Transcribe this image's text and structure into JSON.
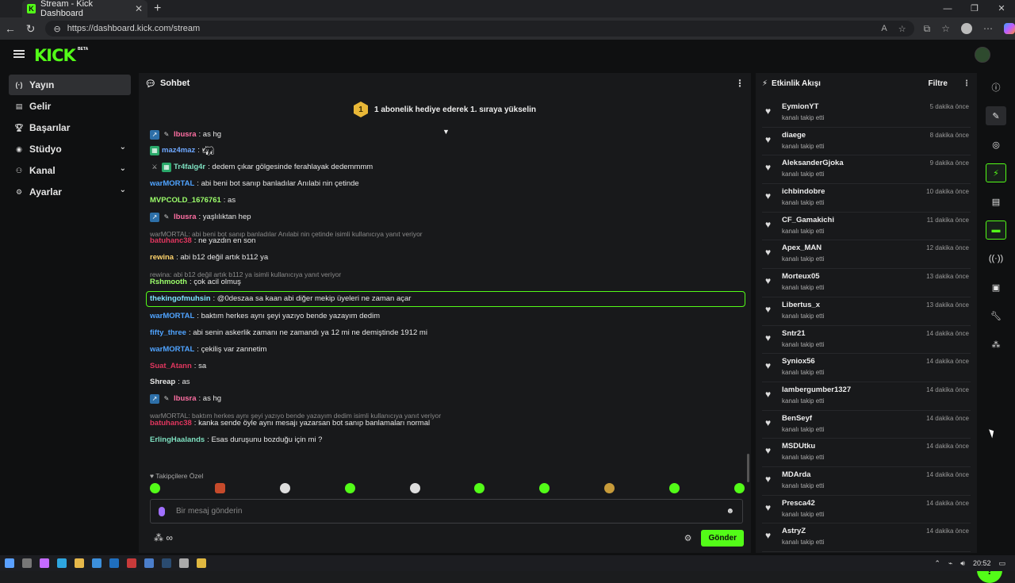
{
  "browser": {
    "tab_title": "Stream - Kick Dashboard",
    "url": "https://dashboard.kick.com/stream"
  },
  "app": {
    "logo": "KICK",
    "beta": "BETA"
  },
  "sidebar": {
    "items": [
      {
        "label": "Yayın",
        "icon": "broadcast-icon"
      },
      {
        "label": "Gelir",
        "icon": "revenue-icon"
      },
      {
        "label": "Başarılar",
        "icon": "trophy-icon"
      },
      {
        "label": "Stüdyo",
        "icon": "studio-icon"
      },
      {
        "label": "Kanal",
        "icon": "channel-icon"
      },
      {
        "label": "Ayarlar",
        "icon": "settings-icon"
      }
    ]
  },
  "chat": {
    "title": "Sohbet",
    "gift_badge": "1",
    "gift_text": "1 abonelik hediye ederek 1. sıraya yükselin",
    "messages": [
      {
        "user": "lbusra",
        "text": ": as hg",
        "color": "#ff6fa3",
        "badges": [
          "mod",
          "pen"
        ]
      },
      {
        "user": "maz4maz",
        "text": ":",
        "color": "#6ea8ff",
        "badges": [
          "gr"
        ],
        "emote": true
      },
      {
        "user": "Tr4falg4r",
        "text": ": dedem çıkar gölgesinde ferahlayak dedemmmm",
        "color": "#7ee0c0",
        "badges": [
          "sw",
          "gr"
        ]
      },
      {
        "user": "warMORTAL",
        "text": ": abi beni bot sanıp banladılar Anılabi nin çetinde",
        "color": "#4fa3ff"
      },
      {
        "user": "MVPCOLD_1676761",
        "text": ": as",
        "color": "#9cff6b"
      },
      {
        "user": "lbusra",
        "text": ": yaşlılıktan hep",
        "color": "#ff6fa3",
        "badges": [
          "mod",
          "pen"
        ]
      },
      {
        "reply": "warMORTAL: abi beni bot sanıp banladılar Anılabi nin çetinde isimli kullanıcıya yanıt veriyor"
      },
      {
        "user": "batuhanc38",
        "text": ": ne yazdın en son",
        "color": "#e0365e"
      },
      {
        "user": "rewina",
        "text": ": abi b12 değil artık b112 ya",
        "color": "#ffd36b"
      },
      {
        "reply": "rewina: abi b12 değil artık b112 ya isimli kullanıcıya yanıt veriyor"
      },
      {
        "user": "Rshmooth",
        "text": ": çok acil olmuş",
        "color": "#9cff6b"
      },
      {
        "user": "thekingofmuhsin",
        "text": ": @0deszaa sa kaan abi diğer mekip üyeleri ne zaman açar",
        "color": "#7ee0ff",
        "highlight": true
      },
      {
        "user": "warMORTAL",
        "text": ": baktım herkes aynı şeyi yazıyo bende yazayım dedim",
        "color": "#4fa3ff"
      },
      {
        "user": "fifty_three",
        "text": ": abi senin askerlik zamanı ne zamandı ya 12 mi ne demiştinde 1912 mi",
        "color": "#4fa3ff"
      },
      {
        "user": "warMORTAL",
        "text": ": çekiliş var zannetim",
        "color": "#4fa3ff"
      },
      {
        "user": "Suat_Atann",
        "text": ": sa",
        "color": "#e0365e"
      },
      {
        "user": "Shreap",
        "text": ": as",
        "color": "#e6e6e6"
      },
      {
        "user": "lbusra",
        "text": ": as hg",
        "color": "#ff6fa3",
        "badges": [
          "mod",
          "pen"
        ]
      },
      {
        "reply": "warMORTAL: baktım herkes aynı şeyi yazıyo bende yazayım dedim isimli kullanıcıya yanıt veriyor"
      },
      {
        "user": "batuhanc38",
        "text": ": kanka sende öyle aynı mesajı yazarsan bot sanıp banlamaları normal",
        "color": "#e0365e"
      },
      {
        "user": "ErlingHaalands",
        "text": ": Esas duruşunu bozduğu için mi ?",
        "color": "#7ee0c0"
      }
    ],
    "followers_only": "Takipçilere Özel",
    "input_placeholder": "Bir mesaj gönderin",
    "send_label": "Gönder"
  },
  "activity": {
    "title": "Etkinlik Akışı",
    "filter_label": "Filtre",
    "events": [
      {
        "name": "EymionYT",
        "desc": "kanalı takip etti",
        "time": "5 dakika önce"
      },
      {
        "name": "diaege",
        "desc": "kanalı takip etti",
        "time": "8 dakika önce"
      },
      {
        "name": "AleksanderGjoka",
        "desc": "kanalı takip etti",
        "time": "9 dakika önce"
      },
      {
        "name": "ichbindobre",
        "desc": "kanalı takip etti",
        "time": "10 dakika önce"
      },
      {
        "name": "CF_Gamakichi",
        "desc": "kanalı takip etti",
        "time": "11 dakika önce"
      },
      {
        "name": "Apex_MAN",
        "desc": "kanalı takip etti",
        "time": "12 dakika önce"
      },
      {
        "name": "Morteux05",
        "desc": "kanalı takip etti",
        "time": "13 dakika önce"
      },
      {
        "name": "Libertus_x",
        "desc": "kanalı takip etti",
        "time": "13 dakika önce"
      },
      {
        "name": "Sntr21",
        "desc": "kanalı takip etti",
        "time": "14 dakika önce"
      },
      {
        "name": "Syniox56",
        "desc": "kanalı takip etti",
        "time": "14 dakika önce"
      },
      {
        "name": "lambergumber1327",
        "desc": "kanalı takip etti",
        "time": "14 dakika önce"
      },
      {
        "name": "BenSeyf",
        "desc": "kanalı takip etti",
        "time": "14 dakika önce"
      },
      {
        "name": "MSDUtku",
        "desc": "kanalı takip etti",
        "time": "14 dakika önce"
      },
      {
        "name": "MDArda",
        "desc": "kanalı takip etti",
        "time": "14 dakika önce"
      },
      {
        "name": "Presca42",
        "desc": "kanalı takip etti",
        "time": "14 dakika önce"
      },
      {
        "name": "AstryZ",
        "desc": "kanalı takip etti",
        "time": "14 dakika önce"
      }
    ]
  },
  "taskbar": {
    "time": "20:52"
  },
  "colors": {
    "accent": "#53fc18"
  }
}
